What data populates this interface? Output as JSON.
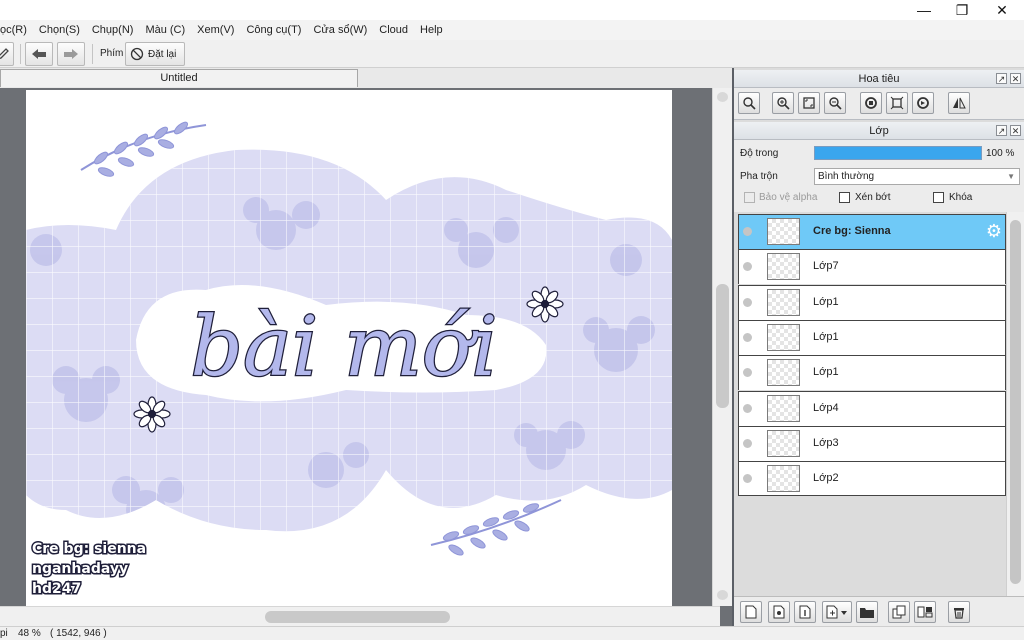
{
  "window": {
    "minimize_glyph": "—",
    "maximize_glyph": "❐",
    "close_glyph": "✕"
  },
  "menu": [
    "ọc(R)",
    "Chọn(S)",
    "Chụp(N)",
    "Màu (C)",
    "Xem(V)",
    "Công cụ(T)",
    "Cửa sổ(W)",
    "Cloud",
    "Help"
  ],
  "toolbar": {
    "key_label": "Phím",
    "reset_label": "Đặt lại",
    "undo_icon": "undo-arrow-icon",
    "redo_icon": "redo-arrow-icon"
  },
  "document": {
    "tab_title": "Untitled"
  },
  "artwork": {
    "headline": "bài mới",
    "credits": [
      "Cre bg: sienna",
      "nganhadayy",
      "hd247"
    ],
    "colors": {
      "lavender": "#dcdcf4",
      "flower": "#c2c3ea",
      "grid": "#ffffff",
      "ink": "#1f1f3a",
      "accent": "#8f95d8"
    }
  },
  "status": {
    "dpi_label": "pi",
    "zoom": "48 %",
    "coords": "( 1542, 946 )"
  },
  "navigator": {
    "title": "Hoa tiêu"
  },
  "layers_panel": {
    "title": "Lớp",
    "opacity_label": "Độ trong",
    "opacity_value": "100 %",
    "opacity_fraction": 1.0,
    "blend_label": "Pha trộn",
    "blend_value": "Bình thường",
    "protect_alpha": "Bảo vệ alpha",
    "clipping": "Xén bớt",
    "lock": "Khóa",
    "selected_color": "#6fc9f7",
    "layers": [
      {
        "name": "Cre bg: Sienna",
        "selected": true
      },
      {
        "name": "Lớp7",
        "selected": false
      },
      {
        "name": "Lớp1",
        "selected": false
      },
      {
        "name": "Lớp1",
        "selected": false
      },
      {
        "name": "Lớp1",
        "selected": false
      },
      {
        "name": "Lớp4",
        "selected": false
      },
      {
        "name": "Lớp3",
        "selected": false
      },
      {
        "name": "Lớp2",
        "selected": false
      }
    ]
  }
}
